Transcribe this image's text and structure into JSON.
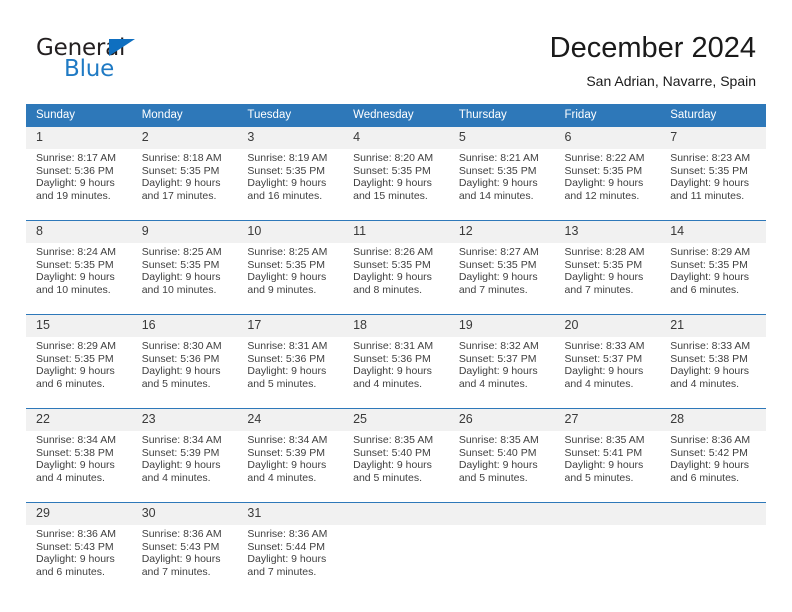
{
  "brand": {
    "line1": "General",
    "line2": "Blue",
    "triangle_color": "#0f6fc0",
    "line2_color": "#1f7ac4"
  },
  "header": {
    "title": "December 2024",
    "subtitle": "San Adrian, Navarre, Spain"
  },
  "theme": {
    "header_blue": "#2e78b9",
    "datenum_band": "#f1f1f1",
    "text": "#3f3f3f"
  },
  "weekday_headers": [
    "Sunday",
    "Monday",
    "Tuesday",
    "Wednesday",
    "Thursday",
    "Friday",
    "Saturday"
  ],
  "weeks": [
    {
      "days": [
        {
          "date": "1",
          "sunrise": "Sunrise: 8:17 AM",
          "sunset": "Sunset: 5:36 PM",
          "daylight1": "Daylight: 9 hours",
          "daylight2": "and 19 minutes."
        },
        {
          "date": "2",
          "sunrise": "Sunrise: 8:18 AM",
          "sunset": "Sunset: 5:35 PM",
          "daylight1": "Daylight: 9 hours",
          "daylight2": "and 17 minutes."
        },
        {
          "date": "3",
          "sunrise": "Sunrise: 8:19 AM",
          "sunset": "Sunset: 5:35 PM",
          "daylight1": "Daylight: 9 hours",
          "daylight2": "and 16 minutes."
        },
        {
          "date": "4",
          "sunrise": "Sunrise: 8:20 AM",
          "sunset": "Sunset: 5:35 PM",
          "daylight1": "Daylight: 9 hours",
          "daylight2": "and 15 minutes."
        },
        {
          "date": "5",
          "sunrise": "Sunrise: 8:21 AM",
          "sunset": "Sunset: 5:35 PM",
          "daylight1": "Daylight: 9 hours",
          "daylight2": "and 14 minutes."
        },
        {
          "date": "6",
          "sunrise": "Sunrise: 8:22 AM",
          "sunset": "Sunset: 5:35 PM",
          "daylight1": "Daylight: 9 hours",
          "daylight2": "and 12 minutes."
        },
        {
          "date": "7",
          "sunrise": "Sunrise: 8:23 AM",
          "sunset": "Sunset: 5:35 PM",
          "daylight1": "Daylight: 9 hours",
          "daylight2": "and 11 minutes."
        }
      ]
    },
    {
      "days": [
        {
          "date": "8",
          "sunrise": "Sunrise: 8:24 AM",
          "sunset": "Sunset: 5:35 PM",
          "daylight1": "Daylight: 9 hours",
          "daylight2": "and 10 minutes."
        },
        {
          "date": "9",
          "sunrise": "Sunrise: 8:25 AM",
          "sunset": "Sunset: 5:35 PM",
          "daylight1": "Daylight: 9 hours",
          "daylight2": "and 10 minutes."
        },
        {
          "date": "10",
          "sunrise": "Sunrise: 8:25 AM",
          "sunset": "Sunset: 5:35 PM",
          "daylight1": "Daylight: 9 hours",
          "daylight2": "and 9 minutes."
        },
        {
          "date": "11",
          "sunrise": "Sunrise: 8:26 AM",
          "sunset": "Sunset: 5:35 PM",
          "daylight1": "Daylight: 9 hours",
          "daylight2": "and 8 minutes."
        },
        {
          "date": "12",
          "sunrise": "Sunrise: 8:27 AM",
          "sunset": "Sunset: 5:35 PM",
          "daylight1": "Daylight: 9 hours",
          "daylight2": "and 7 minutes."
        },
        {
          "date": "13",
          "sunrise": "Sunrise: 8:28 AM",
          "sunset": "Sunset: 5:35 PM",
          "daylight1": "Daylight: 9 hours",
          "daylight2": "and 7 minutes."
        },
        {
          "date": "14",
          "sunrise": "Sunrise: 8:29 AM",
          "sunset": "Sunset: 5:35 PM",
          "daylight1": "Daylight: 9 hours",
          "daylight2": "and 6 minutes."
        }
      ]
    },
    {
      "days": [
        {
          "date": "15",
          "sunrise": "Sunrise: 8:29 AM",
          "sunset": "Sunset: 5:35 PM",
          "daylight1": "Daylight: 9 hours",
          "daylight2": "and 6 minutes."
        },
        {
          "date": "16",
          "sunrise": "Sunrise: 8:30 AM",
          "sunset": "Sunset: 5:36 PM",
          "daylight1": "Daylight: 9 hours",
          "daylight2": "and 5 minutes."
        },
        {
          "date": "17",
          "sunrise": "Sunrise: 8:31 AM",
          "sunset": "Sunset: 5:36 PM",
          "daylight1": "Daylight: 9 hours",
          "daylight2": "and 5 minutes."
        },
        {
          "date": "18",
          "sunrise": "Sunrise: 8:31 AM",
          "sunset": "Sunset: 5:36 PM",
          "daylight1": "Daylight: 9 hours",
          "daylight2": "and 4 minutes."
        },
        {
          "date": "19",
          "sunrise": "Sunrise: 8:32 AM",
          "sunset": "Sunset: 5:37 PM",
          "daylight1": "Daylight: 9 hours",
          "daylight2": "and 4 minutes."
        },
        {
          "date": "20",
          "sunrise": "Sunrise: 8:33 AM",
          "sunset": "Sunset: 5:37 PM",
          "daylight1": "Daylight: 9 hours",
          "daylight2": "and 4 minutes."
        },
        {
          "date": "21",
          "sunrise": "Sunrise: 8:33 AM",
          "sunset": "Sunset: 5:38 PM",
          "daylight1": "Daylight: 9 hours",
          "daylight2": "and 4 minutes."
        }
      ]
    },
    {
      "days": [
        {
          "date": "22",
          "sunrise": "Sunrise: 8:34 AM",
          "sunset": "Sunset: 5:38 PM",
          "daylight1": "Daylight: 9 hours",
          "daylight2": "and 4 minutes."
        },
        {
          "date": "23",
          "sunrise": "Sunrise: 8:34 AM",
          "sunset": "Sunset: 5:39 PM",
          "daylight1": "Daylight: 9 hours",
          "daylight2": "and 4 minutes."
        },
        {
          "date": "24",
          "sunrise": "Sunrise: 8:34 AM",
          "sunset": "Sunset: 5:39 PM",
          "daylight1": "Daylight: 9 hours",
          "daylight2": "and 4 minutes."
        },
        {
          "date": "25",
          "sunrise": "Sunrise: 8:35 AM",
          "sunset": "Sunset: 5:40 PM",
          "daylight1": "Daylight: 9 hours",
          "daylight2": "and 5 minutes."
        },
        {
          "date": "26",
          "sunrise": "Sunrise: 8:35 AM",
          "sunset": "Sunset: 5:40 PM",
          "daylight1": "Daylight: 9 hours",
          "daylight2": "and 5 minutes."
        },
        {
          "date": "27",
          "sunrise": "Sunrise: 8:35 AM",
          "sunset": "Sunset: 5:41 PM",
          "daylight1": "Daylight: 9 hours",
          "daylight2": "and 5 minutes."
        },
        {
          "date": "28",
          "sunrise": "Sunrise: 8:36 AM",
          "sunset": "Sunset: 5:42 PM",
          "daylight1": "Daylight: 9 hours",
          "daylight2": "and 6 minutes."
        }
      ]
    },
    {
      "days": [
        {
          "date": "29",
          "sunrise": "Sunrise: 8:36 AM",
          "sunset": "Sunset: 5:43 PM",
          "daylight1": "Daylight: 9 hours",
          "daylight2": "and 6 minutes."
        },
        {
          "date": "30",
          "sunrise": "Sunrise: 8:36 AM",
          "sunset": "Sunset: 5:43 PM",
          "daylight1": "Daylight: 9 hours",
          "daylight2": "and 7 minutes."
        },
        {
          "date": "31",
          "sunrise": "Sunrise: 8:36 AM",
          "sunset": "Sunset: 5:44 PM",
          "daylight1": "Daylight: 9 hours",
          "daylight2": "and 7 minutes."
        },
        {
          "date": "",
          "sunrise": "",
          "sunset": "",
          "daylight1": "",
          "daylight2": ""
        },
        {
          "date": "",
          "sunrise": "",
          "sunset": "",
          "daylight1": "",
          "daylight2": ""
        },
        {
          "date": "",
          "sunrise": "",
          "sunset": "",
          "daylight1": "",
          "daylight2": ""
        },
        {
          "date": "",
          "sunrise": "",
          "sunset": "",
          "daylight1": "",
          "daylight2": ""
        }
      ]
    }
  ]
}
